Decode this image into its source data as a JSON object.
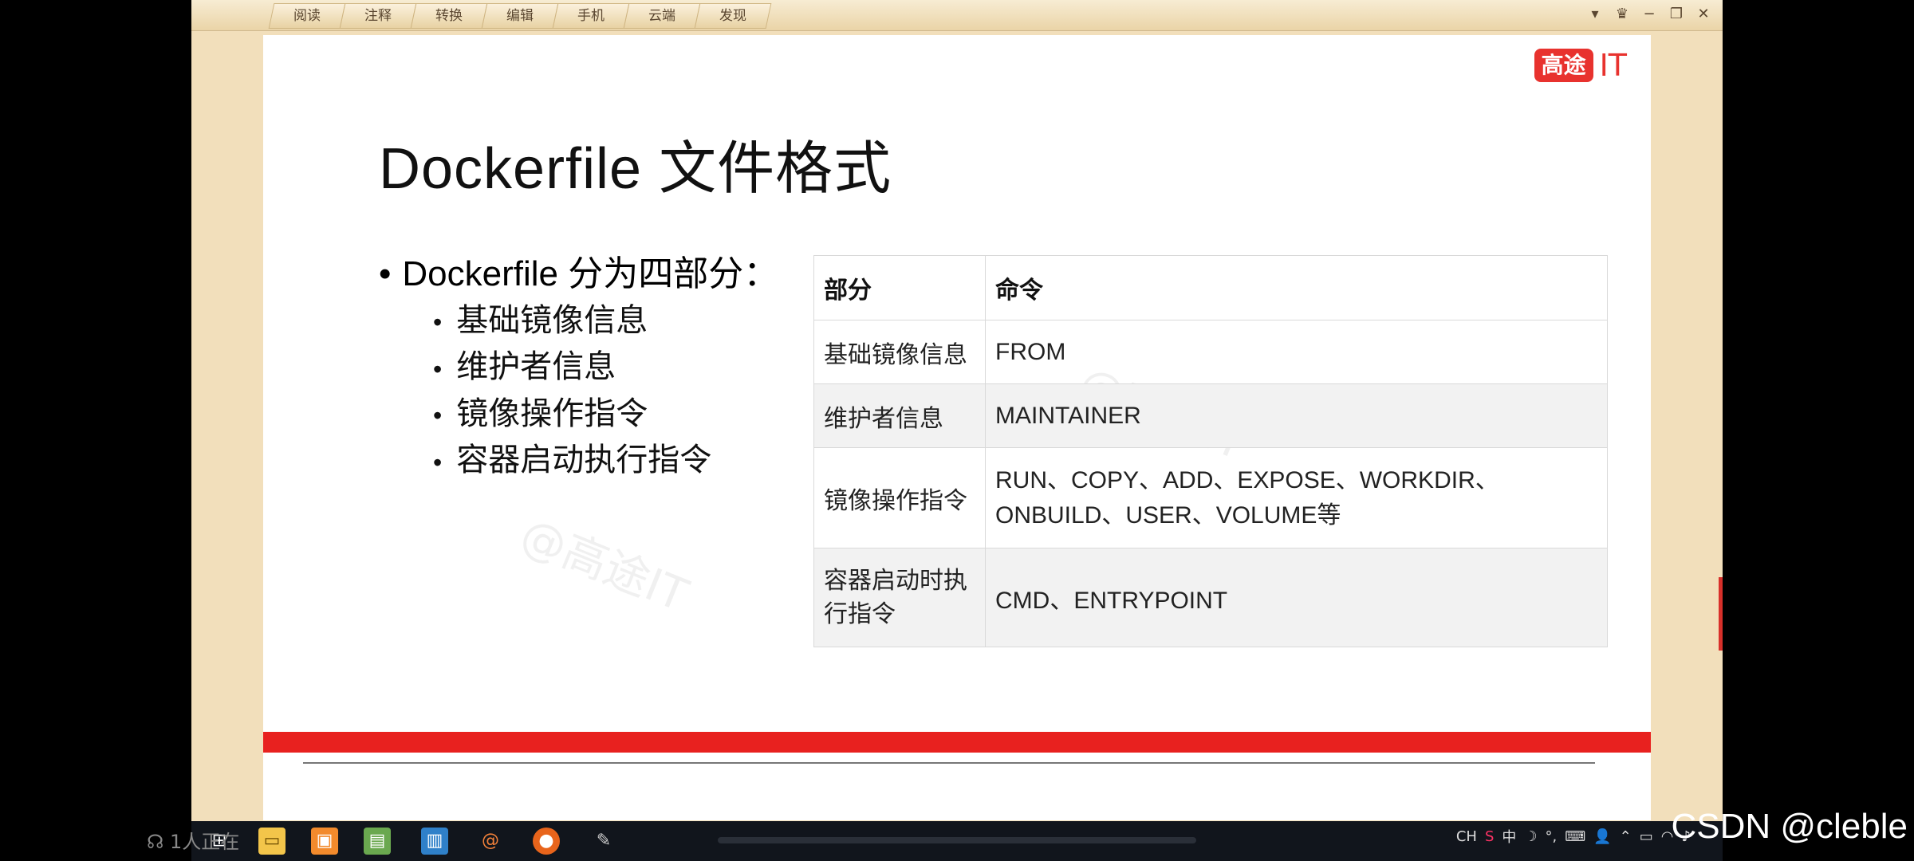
{
  "menubar": {
    "tabs": [
      "阅读",
      "注释",
      "转换",
      "编辑",
      "手机",
      "云端",
      "发现"
    ],
    "window_controls": [
      "▾",
      "♛",
      "−",
      "❐",
      "✕"
    ]
  },
  "slide": {
    "brand_badge": "高途",
    "brand_suffix": "IT",
    "title": "Dockerfile 文件格式",
    "bullet_main": "Dockerfile 分为四部分：",
    "sub_bullets": [
      "基础镜像信息",
      "维护者信息",
      "镜像操作指令",
      "容器启动执行指令"
    ],
    "watermark": "@高途IT",
    "table": {
      "headers": [
        "部分",
        "命令"
      ],
      "rows": [
        [
          "基础镜像信息",
          "FROM"
        ],
        [
          "维护者信息",
          "MAINTAINER"
        ],
        [
          "镜像操作指令",
          "RUN、COPY、ADD、EXPOSE、WORKDIR、ONBUILD、USER、VOLUME等"
        ],
        [
          "容器启动时执行指令",
          "CMD、ENTRYPOINT"
        ]
      ]
    }
  },
  "taskbar": {
    "viewer_text": "1人正在",
    "tray": [
      "CH",
      "S",
      "中",
      "☽",
      "°,",
      "⌨",
      "👤"
    ]
  },
  "overlay": {
    "csdn_credit": "CSDN @cleble"
  }
}
